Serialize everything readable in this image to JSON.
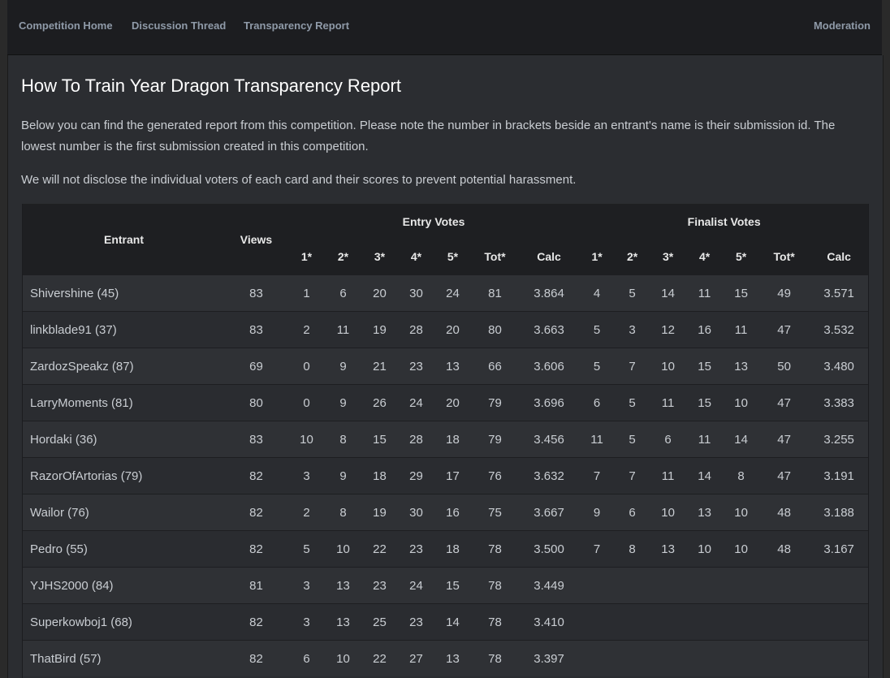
{
  "nav": {
    "left": [
      "Competition Home",
      "Discussion Thread",
      "Transparency Report"
    ],
    "right": "Moderation"
  },
  "page": {
    "title": "How To Train Year Dragon Transparency Report",
    "intro": "Below you can find the generated report from this competition. Please note the number in brackets beside an entrant's name is their submission id. The lowest number is the first submission created in this competition.",
    "privacy_note": "We will not disclose the individual voters of each card and their scores to prevent potential harassment."
  },
  "table": {
    "headers": {
      "entrant": "Entrant",
      "views": "Views",
      "entry_votes": "Entry Votes",
      "finalist_votes": "Finalist Votes",
      "sub": [
        "1*",
        "2*",
        "3*",
        "4*",
        "5*",
        "Tot*",
        "Calc"
      ]
    },
    "rows": [
      {
        "entrant": "Shivershine (45)",
        "views": "83",
        "entry": [
          "1",
          "6",
          "20",
          "30",
          "24",
          "81",
          "3.864"
        ],
        "finalist": [
          "4",
          "5",
          "14",
          "11",
          "15",
          "49",
          "3.571"
        ]
      },
      {
        "entrant": "linkblade91 (37)",
        "views": "83",
        "entry": [
          "2",
          "11",
          "19",
          "28",
          "20",
          "80",
          "3.663"
        ],
        "finalist": [
          "5",
          "3",
          "12",
          "16",
          "11",
          "47",
          "3.532"
        ]
      },
      {
        "entrant": "ZardozSpeakz (87)",
        "views": "69",
        "entry": [
          "0",
          "9",
          "21",
          "23",
          "13",
          "66",
          "3.606"
        ],
        "finalist": [
          "5",
          "7",
          "10",
          "15",
          "13",
          "50",
          "3.480"
        ]
      },
      {
        "entrant": "LarryMoments (81)",
        "views": "80",
        "entry": [
          "0",
          "9",
          "26",
          "24",
          "20",
          "79",
          "3.696"
        ],
        "finalist": [
          "6",
          "5",
          "11",
          "15",
          "10",
          "47",
          "3.383"
        ]
      },
      {
        "entrant": "Hordaki (36)",
        "views": "83",
        "entry": [
          "10",
          "8",
          "15",
          "28",
          "18",
          "79",
          "3.456"
        ],
        "finalist": [
          "11",
          "5",
          "6",
          "11",
          "14",
          "47",
          "3.255"
        ]
      },
      {
        "entrant": "RazorOfArtorias (79)",
        "views": "82",
        "entry": [
          "3",
          "9",
          "18",
          "29",
          "17",
          "76",
          "3.632"
        ],
        "finalist": [
          "7",
          "7",
          "11",
          "14",
          "8",
          "47",
          "3.191"
        ]
      },
      {
        "entrant": "Wailor (76)",
        "views": "82",
        "entry": [
          "2",
          "8",
          "19",
          "30",
          "16",
          "75",
          "3.667"
        ],
        "finalist": [
          "9",
          "6",
          "10",
          "13",
          "10",
          "48",
          "3.188"
        ]
      },
      {
        "entrant": "Pedro (55)",
        "views": "82",
        "entry": [
          "5",
          "10",
          "22",
          "23",
          "18",
          "78",
          "3.500"
        ],
        "finalist": [
          "7",
          "8",
          "13",
          "10",
          "10",
          "48",
          "3.167"
        ]
      },
      {
        "entrant": "YJHS2000 (84)",
        "views": "81",
        "entry": [
          "3",
          "13",
          "23",
          "24",
          "15",
          "78",
          "3.449"
        ],
        "finalist": [
          "",
          "",
          "",
          "",
          "",
          "",
          ""
        ]
      },
      {
        "entrant": "Superkowboj1 (68)",
        "views": "82",
        "entry": [
          "3",
          "13",
          "25",
          "23",
          "14",
          "78",
          "3.410"
        ],
        "finalist": [
          "",
          "",
          "",
          "",
          "",
          "",
          ""
        ]
      },
      {
        "entrant": "ThatBird (57)",
        "views": "82",
        "entry": [
          "6",
          "10",
          "22",
          "27",
          "13",
          "78",
          "3.397"
        ],
        "finalist": [
          "",
          "",
          "",
          "",
          "",
          "",
          ""
        ]
      }
    ]
  }
}
